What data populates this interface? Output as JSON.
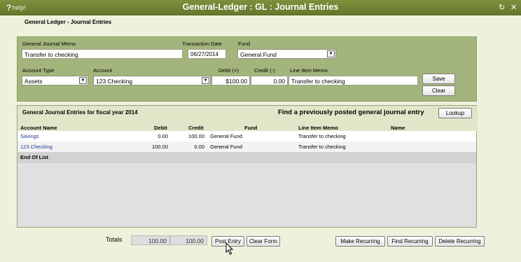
{
  "window": {
    "title": "General-Ledger : GL : Journal Entries",
    "help_label": "help!",
    "help_glyph": "?"
  },
  "page": {
    "heading": "General Ledger - Journal Entries"
  },
  "form": {
    "memo_label": "General Journal Memo",
    "memo_value": "Transfer to checking",
    "date_label": "Transaction Date",
    "date_value": "06/27/2014",
    "fund_label": "Fund",
    "fund_value": "General Fund",
    "account_type_label": "Account Type",
    "account_type_value": "Assets",
    "account_label": "Account",
    "account_value": "123 Checking",
    "debit_label": "Debit (+)",
    "debit_value": "$100.00",
    "credit_label": "Credit (-)",
    "credit_value": "0.00",
    "line_memo_label": "Line Item Memo",
    "line_memo_value": "Transfer to checking",
    "save_label": "Save",
    "clear_label": "Clear"
  },
  "grid": {
    "title": "General Journal Entries for fiscal year 2014",
    "find_text": "Find a previously posted general journal entry",
    "lookup_label": "Lookup",
    "columns": {
      "account": "Account Name",
      "debit": "Debit",
      "credit": "Credit",
      "fund": "Fund",
      "memo": "Line Item Memo",
      "name": "Name"
    },
    "rows": [
      {
        "account": "Savings",
        "debit": "0.00",
        "credit": "100.00",
        "fund": "General Fund",
        "memo": "Transfer to checking",
        "name": ""
      },
      {
        "account": "123 Checking",
        "debit": "100.00",
        "credit": "0.00",
        "fund": "General Fund",
        "memo": "Transfer to checking",
        "name": ""
      }
    ],
    "end_label": "End Of List"
  },
  "footer": {
    "totals_label": "Totals",
    "total_debit": "100.00",
    "total_credit": "100.00",
    "post_label": "Post Entry",
    "clear_form_label": "Clear Form",
    "make_recurring_label": "Make Recurring",
    "find_recurring_label": "Find Recurring",
    "delete_recurring_label": "Delete Recurring"
  },
  "colors": {
    "titlebar": "#6f8032",
    "panel": "#a3b57c",
    "link": "#1a3a8c"
  },
  "icons": [
    "help-icon",
    "refresh-icon",
    "close-icon",
    "dropdown-arrow-icon",
    "mouse-cursor-icon"
  ]
}
